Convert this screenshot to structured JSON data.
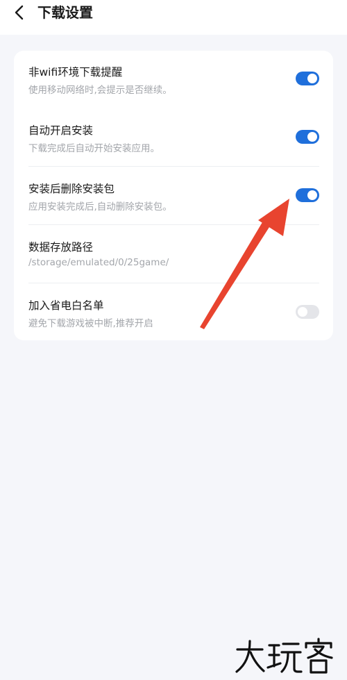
{
  "header": {
    "title": "下载设置",
    "back_icon": "chevron-left-icon"
  },
  "settings": [
    {
      "title": "非wifi环境下载提醒",
      "subtitle": "使用移动网络时,会提示是否继续。",
      "enabled": true
    },
    {
      "title": "自动开启安装",
      "subtitle": "下载完成后自动开始安装应用。",
      "enabled": true
    },
    {
      "title": "安装后删除安装包",
      "subtitle": "应用安装完成后,自动删除安装包。",
      "enabled": true
    },
    {
      "title": "数据存放路径",
      "subtitle": "/storage/emulated/0/25game/"
    },
    {
      "title": "加入省电白名单",
      "subtitle": "避免下载游戏被中断,推荐开启",
      "enabled": false
    }
  ],
  "colors": {
    "toggle_on": "#1f6fdb",
    "toggle_off": "#e4e5e9",
    "annotation_arrow": "#e8442f"
  },
  "watermark": {
    "text": "大玩客"
  }
}
